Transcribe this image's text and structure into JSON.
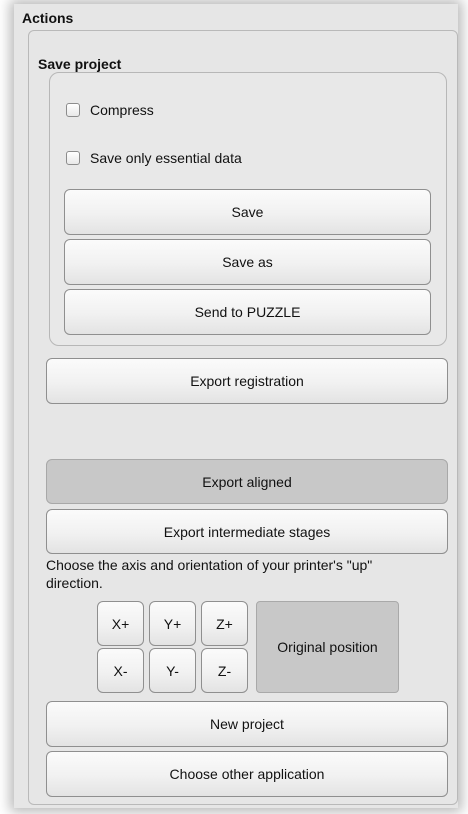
{
  "panel": {
    "title": "Actions"
  },
  "save_group": {
    "title": "Save project",
    "checkboxes": [
      {
        "label": "Compress",
        "checked": false
      },
      {
        "label": "Save only essential data",
        "checked": false
      }
    ],
    "buttons": {
      "save": "Save",
      "save_as": "Save as",
      "send": "Send to PUZZLE"
    }
  },
  "buttons": {
    "export_registration": "Export registration",
    "export_aligned": "Export aligned",
    "export_intermediate": "Export intermediate stages",
    "new_project": "New project",
    "choose_other": "Choose other application"
  },
  "orientation": {
    "help": "Choose the axis and orientation of your printer's \"up\" direction.",
    "axes": [
      "X+",
      "Y+",
      "Z+",
      "X-",
      "Y-",
      "Z-"
    ],
    "original_position": "Original position"
  }
}
